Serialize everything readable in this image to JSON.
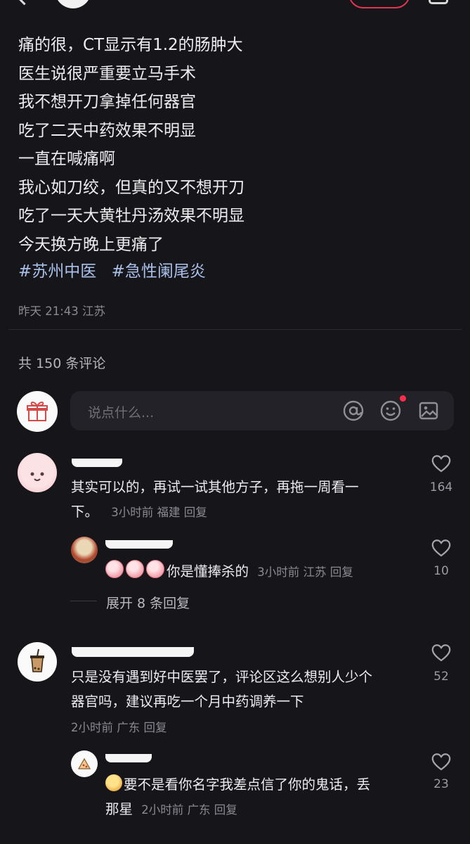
{
  "post": {
    "lines": [
      "痛的很，CT显示有1.2的肠肿大",
      "医生说很严重要立马手术",
      "我不想开刀拿掉任何器官",
      "吃了二天中药效果不明显",
      "一直在喊痛啊",
      "我心如刀绞，但真的又不想开刀",
      "吃了一天大黄牡丹汤效果不明显",
      "今天换方晚上更痛了"
    ],
    "tags": [
      "#苏州中医",
      "#急性阑尾炎"
    ],
    "time": "昨天 21:43",
    "location": "江苏"
  },
  "comment_count": "共 150 条评论",
  "input": {
    "placeholder": "说点什么..."
  },
  "comments": [
    {
      "text_1": "其实可以的，再试一试其他方子，再拖一周看一",
      "text_2": "下。",
      "time": "3小时前",
      "location": "福建",
      "reply": "回复",
      "likes": "164",
      "sub": {
        "text": "你是懂捧杀的",
        "time": "3小时前",
        "location": "江苏",
        "reply": "回复",
        "likes": "10"
      },
      "expand": "展开 8 条回复"
    },
    {
      "text_1": "只是没有遇到好中医罢了，评论区这么想别人少个",
      "text_2": "器官吗，建议再吃一个月中药调养一下",
      "time": "2小时前",
      "location": "广东",
      "reply": "回复",
      "likes": "52",
      "sub": {
        "text_1": "要不是看你名字我差点信了你的鬼话，丢",
        "text_2": "那星",
        "time": "2小时前",
        "location": "广东",
        "reply": "回复",
        "likes": "23"
      }
    }
  ],
  "colors": {
    "background": "#161519",
    "hashtag": "#a9c0e9",
    "accent_red": "#ff2e4c",
    "muted": "#8a8a92"
  }
}
